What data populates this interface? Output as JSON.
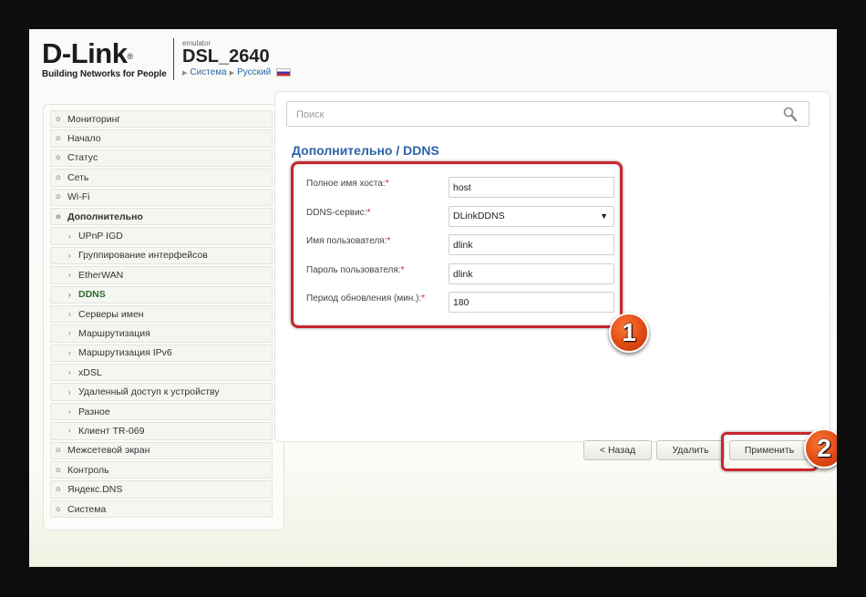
{
  "header": {
    "logo_text": "D-Link",
    "logo_reg": "®",
    "logo_tagline": "Building Networks for People",
    "emulator_label": "emulator",
    "model": "DSL_2640",
    "crumb_system": "Система",
    "crumb_language": "Русский",
    "flag_icon": "russia-flag-icon"
  },
  "sidebar": {
    "items": [
      {
        "label": "Мониторинг",
        "level": 0
      },
      {
        "label": "Начало",
        "level": 0
      },
      {
        "label": "Статус",
        "level": 0
      },
      {
        "label": "Сеть",
        "level": 0
      },
      {
        "label": "Wi-Fi",
        "level": 0
      },
      {
        "label": "Дополнительно",
        "level": 0,
        "expanded": true
      },
      {
        "label": "UPnP IGD",
        "level": 1
      },
      {
        "label": "Группирование интерфейсов",
        "level": 1
      },
      {
        "label": "EtherWAN",
        "level": 1
      },
      {
        "label": "DDNS",
        "level": 1,
        "active": true
      },
      {
        "label": "Серверы имен",
        "level": 1
      },
      {
        "label": "Маршрутизация",
        "level": 1
      },
      {
        "label": "Маршрутизация IPv6",
        "level": 1
      },
      {
        "label": "xDSL",
        "level": 1
      },
      {
        "label": "Удаленный доступ к устройству",
        "level": 1
      },
      {
        "label": "Разное",
        "level": 1
      },
      {
        "label": "Клиент TR-069",
        "level": 1
      },
      {
        "label": "Межсетевой экран",
        "level": 0
      },
      {
        "label": "Контроль",
        "level": 0
      },
      {
        "label": "Яндекс.DNS",
        "level": 0
      },
      {
        "label": "Система",
        "level": 0
      }
    ]
  },
  "main": {
    "search_placeholder": "Поиск",
    "title": "Дополнительно /  DDNS",
    "form": [
      {
        "label": "Полное имя хоста:",
        "value": "host",
        "type": "text"
      },
      {
        "label": "DDNS-сервис:",
        "value": "DLinkDDNS",
        "type": "select"
      },
      {
        "label": "Имя пользователя:",
        "value": "dlink",
        "type": "text"
      },
      {
        "label": "Пароль пользователя:",
        "value": "dlink",
        "type": "text"
      },
      {
        "label": "Период обновления (мин.):",
        "value": "180",
        "type": "text"
      }
    ],
    "required_mark": "*",
    "buttons": {
      "back": "< Назад",
      "delete": "Удалить",
      "apply": "Применить"
    }
  },
  "annotations": {
    "badge1": "1",
    "badge2": "2",
    "highlight_color": "#c9262d",
    "badge_color": "#e04a14"
  }
}
